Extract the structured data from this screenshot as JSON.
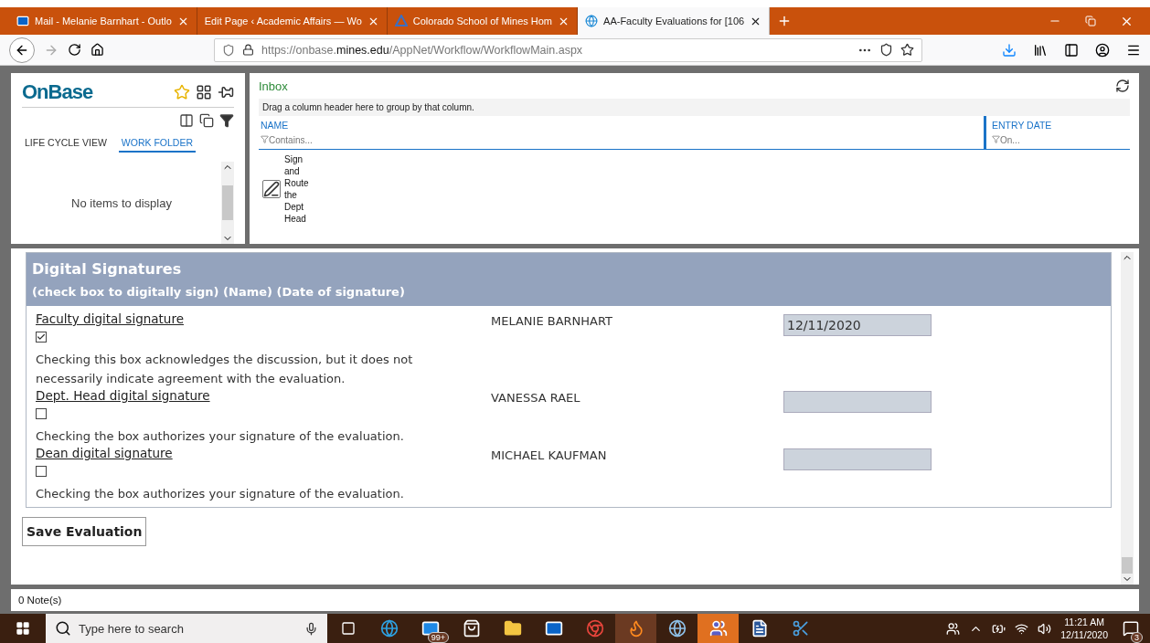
{
  "browser": {
    "tabs": [
      {
        "title": "Mail - Melanie Barnhart - Outlo",
        "selected": false
      },
      {
        "title": "Edit Page ‹ Academic Affairs — Wo",
        "selected": false
      },
      {
        "title": "Colorado School of Mines Hom",
        "selected": false
      },
      {
        "title": "AA-Faculty Evaluations for [106",
        "selected": true
      }
    ],
    "url_prefix": "https://onbase.",
    "url_domain": "mines.edu",
    "url_path": "/AppNet/Workflow/WorkflowMain.aspx"
  },
  "left_panel": {
    "logo": "OnBase",
    "tabs": [
      {
        "label": "LIFE CYCLE VIEW",
        "selected": false
      },
      {
        "label": "WORK FOLDER",
        "selected": true
      }
    ],
    "empty_text": "No items to display"
  },
  "inbox": {
    "title": "Inbox",
    "group_hint": "Drag a column header here to group by that column.",
    "columns": [
      {
        "label": "NAME",
        "filter_placeholder": "Contains..."
      },
      {
        "label": "ENTRY DATE",
        "filter_placeholder": "On..."
      }
    ],
    "rows": [
      {
        "name": "Sign and Route the Dept Head"
      }
    ]
  },
  "form": {
    "title": "Digital Signatures",
    "subtitle": "(check box to digitally sign) (Name) (Date of signature)",
    "signatures": [
      {
        "label": "Faculty digital signature",
        "checked": true,
        "note": "Checking this box acknowledges the discussion, but it does not necessarily indicate agreement with the evaluation.",
        "name": "MELANIE BARNHART",
        "date": "12/11/2020"
      },
      {
        "label": "Dept. Head digital signature",
        "checked": false,
        "note": "Checking the box authorizes your signature of the evaluation.",
        "name": "VANESSA RAEL"
      },
      {
        "label": "Dean digital signature",
        "checked": false,
        "note": "Checking the box authorizes your signature of the evaluation.",
        "name": "MICHAEL KAUFMAN"
      }
    ],
    "save_button": "Save Evaluation"
  },
  "notes_bar": "0 Note(s)",
  "taskbar": {
    "search_placeholder": "Type here to search",
    "mail_badge": "99+",
    "time": "11:21 AM",
    "date": "12/11/2020",
    "notification_count": "3"
  }
}
